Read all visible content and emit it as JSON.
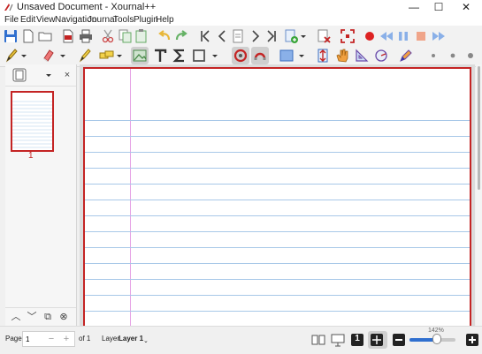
{
  "window": {
    "title": "Unsaved Document - Xournal++",
    "minimize_glyph": "—",
    "maximize_glyph": "☐",
    "close_glyph": "✕"
  },
  "menu": {
    "items": [
      "File",
      "Edit",
      "View",
      "Navigation",
      "Journal",
      "Tools",
      "Plugin",
      "Help"
    ]
  },
  "sidebar": {
    "close_glyph": "×",
    "page_number": "1"
  },
  "status": {
    "page_label": "Page",
    "page_value": "1",
    "page_total": "of 1",
    "layer_label": "Layer",
    "layer_value": "Layer 1",
    "zoom_label": "142%",
    "zoom_fraction": 0.6,
    "single_page_glyph": "1"
  },
  "colors": {
    "accent": "#c42424",
    "rule_line": "#a8c8e8",
    "margin_line": "#e6a3e6",
    "highlight": "#2f6fcf"
  },
  "icons": [
    "save-icon",
    "new-icon",
    "open-icon",
    "export-pdf-icon",
    "print-icon",
    "cut-icon",
    "copy-icon",
    "paste-icon",
    "undo-icon",
    "redo-icon",
    "first-page-icon",
    "previous-page-icon",
    "goto-page-icon",
    "next-page-icon",
    "last-page-icon",
    "insert-page-icon",
    "delete-page-icon",
    "fullscreen-icon",
    "record-icon",
    "rewind-icon",
    "pause-icon",
    "stop-icon",
    "forward-icon",
    "pen-icon",
    "eraser-icon",
    "highlighter-icon",
    "select-icon",
    "image-icon",
    "text-icon",
    "tex-icon",
    "shape-icon",
    "rotation-snap-icon",
    "grid-snap-icon",
    "fill-color-icon",
    "vertical-space-icon",
    "hand-icon",
    "setsquare-icon",
    "compass-icon",
    "color-picker-icon"
  ]
}
